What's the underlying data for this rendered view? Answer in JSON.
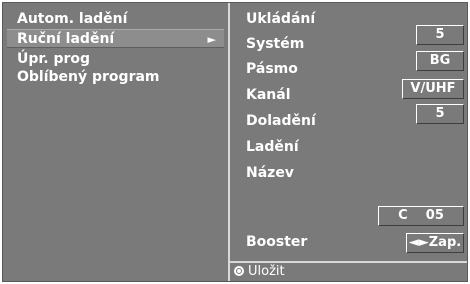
{
  "menu": {
    "items": [
      {
        "label": "Autom. ladění"
      },
      {
        "label": "Ruční ladění",
        "arrow": "►"
      },
      {
        "label": "Úpr. prog"
      },
      {
        "label": "Oblíbený program"
      }
    ]
  },
  "params": {
    "ukladani": {
      "label": "Ukládání",
      "value": "5"
    },
    "system": {
      "label": "Systém",
      "value": "BG"
    },
    "pasmo": {
      "label": "Pásmo",
      "value": "V/UHF"
    },
    "kanal": {
      "label": "Kanál",
      "value": "5"
    },
    "doladeni": {
      "label": "Doladění"
    },
    "ladeni": {
      "label": "Ladění"
    },
    "nazev": {
      "label": "Název",
      "value": "C    05"
    },
    "booster": {
      "label": "Booster",
      "value": "◄►Zap."
    }
  },
  "status": {
    "label": "Uložit"
  },
  "colors": {
    "panel": "#7a7a7a",
    "highlight": "#8d8d8d",
    "text": "#ffffff"
  }
}
